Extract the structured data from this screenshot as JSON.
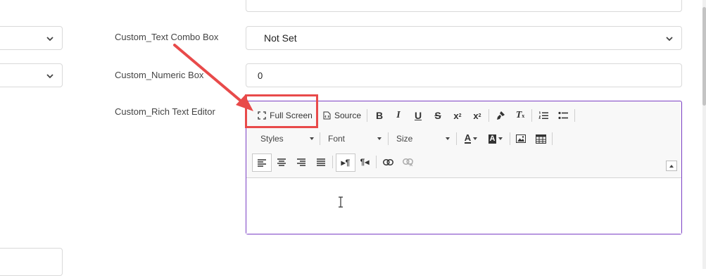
{
  "fields": {
    "text_combo": {
      "label": "Custom_Text Combo Box",
      "value": "Not Set"
    },
    "numeric": {
      "label": "Custom_Numeric Box",
      "value": "0"
    },
    "rich_text": {
      "label": "Custom_Rich Text Editor"
    }
  },
  "toolbar": {
    "full_screen": "Full Screen",
    "source": "Source",
    "styles": "Styles",
    "font": "Font",
    "size": "Size"
  },
  "annotation": {
    "color": "#e84a4a"
  },
  "accent": "#7b3fc4"
}
